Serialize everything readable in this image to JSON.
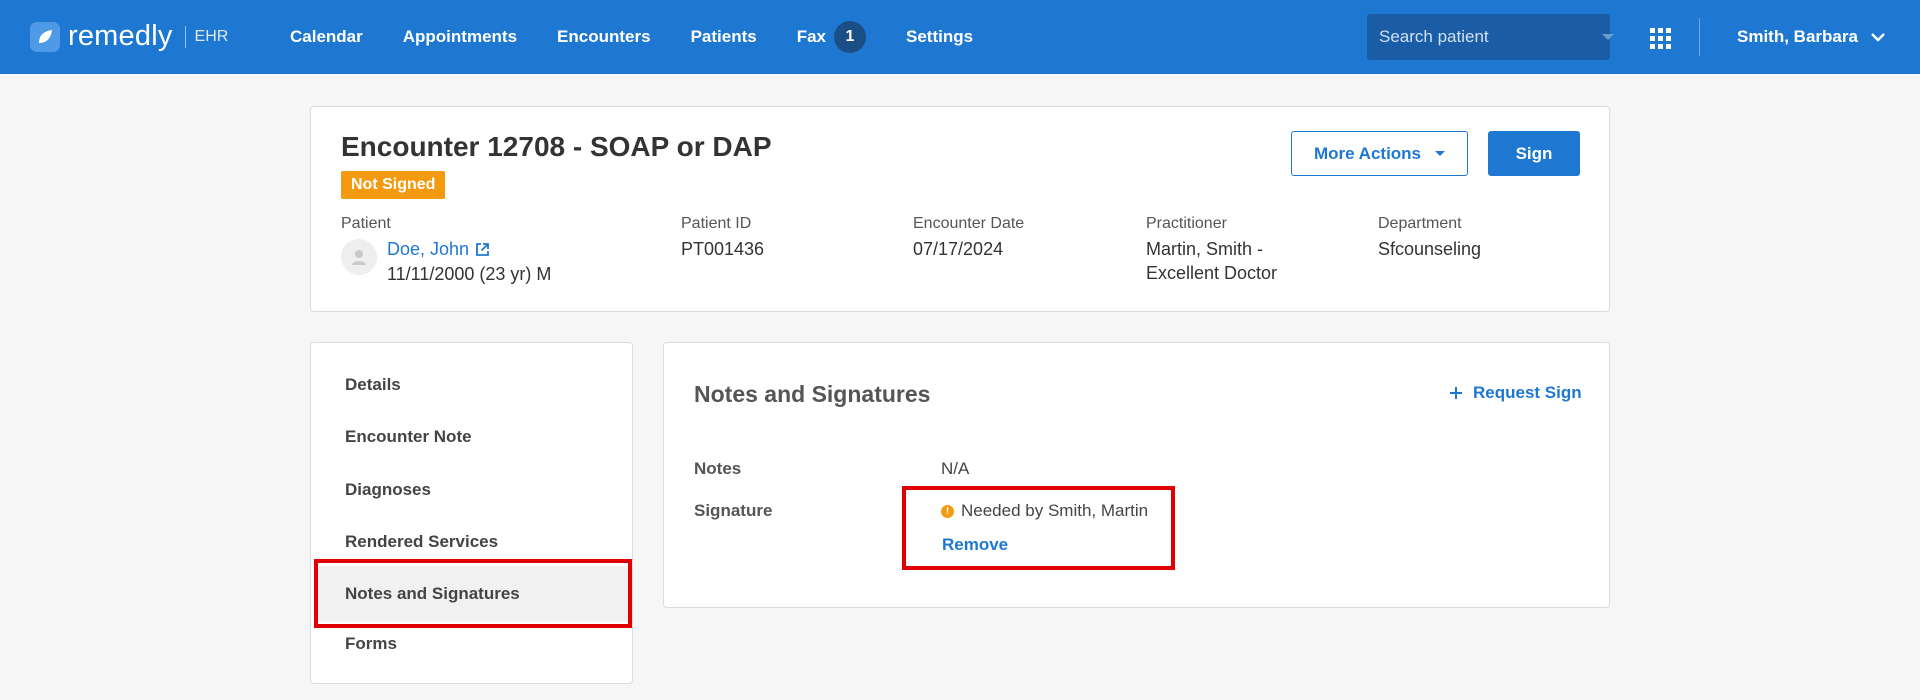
{
  "brand": {
    "name": "remedly",
    "product": "EHR"
  },
  "nav": {
    "items": [
      {
        "label": "Calendar"
      },
      {
        "label": "Appointments"
      },
      {
        "label": "Encounters"
      },
      {
        "label": "Patients"
      },
      {
        "label": "Fax",
        "badge": "1"
      },
      {
        "label": "Settings"
      }
    ]
  },
  "search": {
    "placeholder": "Search patient",
    "value": ""
  },
  "user": {
    "name": "Smith, Barbara"
  },
  "encounter": {
    "title": "Encounter 12708 - SOAP or DAP",
    "status": "Not Signed",
    "more_actions_label": "More Actions",
    "sign_label": "Sign",
    "patient": {
      "label": "Patient",
      "name": "Doe, John",
      "dob": "11/11/2000 (23 yr) M"
    },
    "patient_id": {
      "label": "Patient ID",
      "value": "PT001436"
    },
    "encounter_date": {
      "label": "Encounter Date",
      "value": "07/17/2024"
    },
    "practitioner": {
      "label": "Practitioner",
      "value": "Martin, Smith - Excellent Doctor"
    },
    "department": {
      "label": "Department",
      "value": "Sfcounseling"
    }
  },
  "sidebar": {
    "items": [
      {
        "label": "Details"
      },
      {
        "label": "Encounter Note"
      },
      {
        "label": "Diagnoses"
      },
      {
        "label": "Rendered Services"
      },
      {
        "label": "Notes and Signatures",
        "active": true
      },
      {
        "label": "Forms"
      }
    ]
  },
  "section": {
    "title": "Notes and Signatures",
    "request_sign_label": "Request Sign",
    "notes": {
      "label": "Notes",
      "value": "N/A"
    },
    "signature": {
      "label": "Signature",
      "value": "Needed by Smith, Martin",
      "remove_label": "Remove"
    }
  },
  "colors": {
    "primary": "#1e78d2",
    "warning": "#f39a10",
    "highlight": "#e00000"
  }
}
